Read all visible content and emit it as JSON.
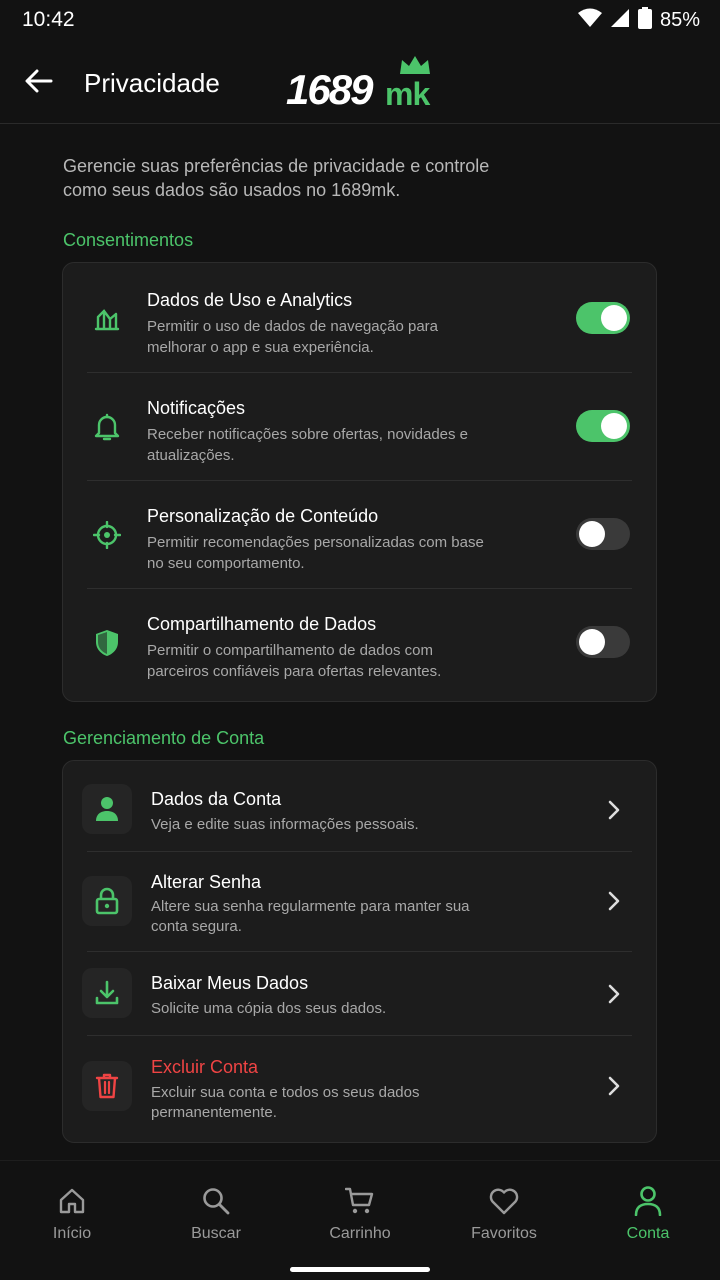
{
  "status": {
    "time": "10:42",
    "battery": "85%"
  },
  "header": {
    "title": "Privacidade",
    "logo_num": "1689",
    "logo_mk": "mk"
  },
  "intro": "Gerencie suas preferências de privacidade e controle como seus dados são usados no 1689mk.",
  "consent": {
    "title": "Consentimentos",
    "items": [
      {
        "title": "Dados de Uso e Analytics",
        "desc": "Permitir o uso de dados de navegação para melhorar o app e sua experiência.",
        "enabled": true,
        "icon": "analytics-icon"
      },
      {
        "title": "Notificações",
        "desc": "Receber notificações sobre ofertas, novidades e atualizações.",
        "enabled": true,
        "icon": "bell-icon"
      },
      {
        "title": "Personalização de Conteúdo",
        "desc": "Permitir recomendações personalizadas com base no seu comportamento.",
        "enabled": false,
        "icon": "crosshair-icon"
      },
      {
        "title": "Compartilhamento de Dados",
        "desc": "Permitir o compartilhamento de dados com parceiros confiáveis para ofertas relevantes.",
        "enabled": false,
        "icon": "shield-icon"
      }
    ]
  },
  "account": {
    "title": "Gerenciamento de Conta",
    "items": [
      {
        "title": "Dados da Conta",
        "desc": "Veja e edite suas informações pessoais.",
        "icon": "person-icon"
      },
      {
        "title": "Alterar Senha",
        "desc": "Altere sua senha regularmente para manter sua conta segura.",
        "icon": "lock-icon"
      },
      {
        "title": "Baixar Meus Dados",
        "desc": "Solicite uma cópia dos seus dados.",
        "icon": "download-icon"
      },
      {
        "title": "Excluir Conta",
        "desc": "Excluir sua conta e todos os seus dados permanentemente.",
        "icon": "trash-icon"
      }
    ]
  },
  "nav": [
    {
      "label": "Início",
      "icon": "home-icon",
      "active": false
    },
    {
      "label": "Buscar",
      "icon": "search-icon",
      "active": false
    },
    {
      "label": "Carrinho",
      "icon": "cart-icon",
      "active": false
    },
    {
      "label": "Favoritos",
      "icon": "heart-icon",
      "active": false
    },
    {
      "label": "Conta",
      "icon": "account-icon",
      "active": true
    }
  ],
  "colors": {
    "accent": "#4cc46a",
    "danger": "#ef4444",
    "background": "#121212",
    "card": "#1c1c1c"
  }
}
